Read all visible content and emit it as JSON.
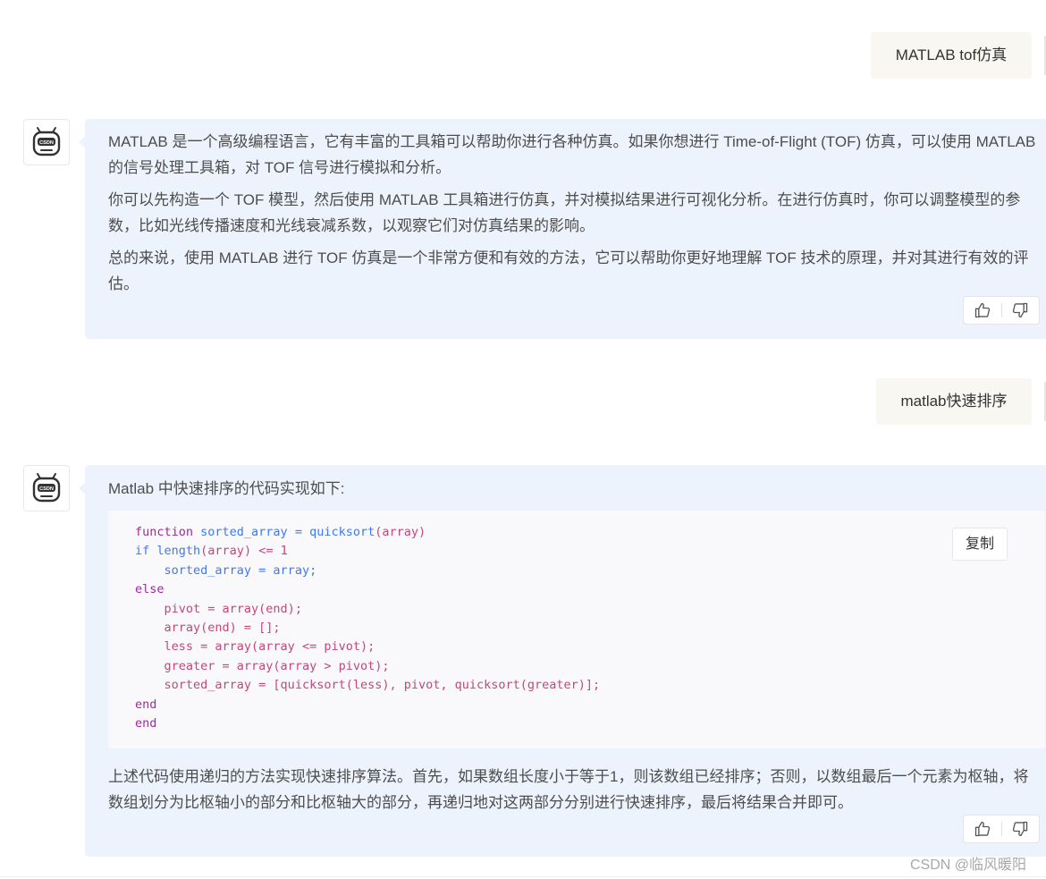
{
  "conversation": {
    "q1": {
      "text": "MATLAB tof仿真"
    },
    "a1": {
      "paragraphs": [
        "MATLAB 是一个高级编程语言，它有丰富的工具箱可以帮助你进行各种仿真。如果你想进行 Time-of-Flight (TOF) 仿真，可以使用 MATLAB 的信号处理工具箱，对 TOF 信号进行模拟和分析。",
        "你可以先构造一个 TOF 模型，然后使用 MATLAB 工具箱进行仿真，并对模拟结果进行可视化分析。在进行仿真时，你可以调整模型的参数，比如光线传播速度和光线衰减系数，以观察它们对仿真结果的影响。",
        "总的来说，使用 MATLAB 进行 TOF 仿真是一个非常方便和有效的方法，它可以帮助你更好地理解 TOF 技术的原理，并对其进行有效的评估。"
      ]
    },
    "q2": {
      "text": "matlab快速排序"
    },
    "a2": {
      "intro": "Matlab 中快速排序的代码实现如下:",
      "code": {
        "copy_label": "复制",
        "lines": [
          {
            "indent": "",
            "parts": [
              {
                "t": "function ",
                "c": "kw"
              },
              {
                "t": "sorted_array",
                "c": "fn"
              },
              {
                "t": " = ",
                "c": "fn"
              },
              {
                "t": "quicksort",
                "c": "fn"
              },
              {
                "t": "(array)",
                "c": "id"
              }
            ]
          },
          {
            "indent": "",
            "parts": [
              {
                "t": "if ",
                "c": "fn"
              },
              {
                "t": "length",
                "c": "fn"
              },
              {
                "t": "(array) <= 1",
                "c": "id"
              }
            ]
          },
          {
            "indent": "    ",
            "parts": [
              {
                "t": "sorted_array = array;",
                "c": "fn"
              }
            ]
          },
          {
            "indent": "",
            "parts": [
              {
                "t": "else",
                "c": "kw"
              }
            ]
          },
          {
            "indent": "    ",
            "parts": [
              {
                "t": "pivot = array(end);",
                "c": "id"
              }
            ]
          },
          {
            "indent": "    ",
            "parts": [
              {
                "t": "array(end) = [];",
                "c": "id"
              }
            ]
          },
          {
            "indent": "    ",
            "parts": [
              {
                "t": "less = array(array <= pivot);",
                "c": "id"
              }
            ]
          },
          {
            "indent": "    ",
            "parts": [
              {
                "t": "greater = array(array > pivot);",
                "c": "id"
              }
            ]
          },
          {
            "indent": "    ",
            "parts": [
              {
                "t": "sorted_array = [quicksort(less), pivot, quicksort(greater)];",
                "c": "id"
              }
            ]
          },
          {
            "indent": "",
            "parts": [
              {
                "t": "end",
                "c": "kw"
              }
            ]
          },
          {
            "indent": "",
            "parts": [
              {
                "t": "end",
                "c": "kw"
              }
            ]
          }
        ]
      },
      "explanation": "上述代码使用递归的方法实现快速排序算法。首先，如果数组长度小于等于1，则该数组已经排序；否则，以数组最后一个元素为枢轴，将数组划分为比枢轴小的部分和比枢轴大的部分，再递归地对这两部分分别进行快速排序，最后将结果合并即可。"
    }
  },
  "avatar": {
    "label": "CSDN"
  },
  "icons": {
    "like": "thumbs-up-icon",
    "dislike": "thumbs-down-icon"
  },
  "colors": {
    "bot_bubble": "#edf3fc",
    "user_bubble": "#f9f7f1",
    "code_bg": "#f9f9fb"
  },
  "watermark": "CSDN @临风暖阳"
}
